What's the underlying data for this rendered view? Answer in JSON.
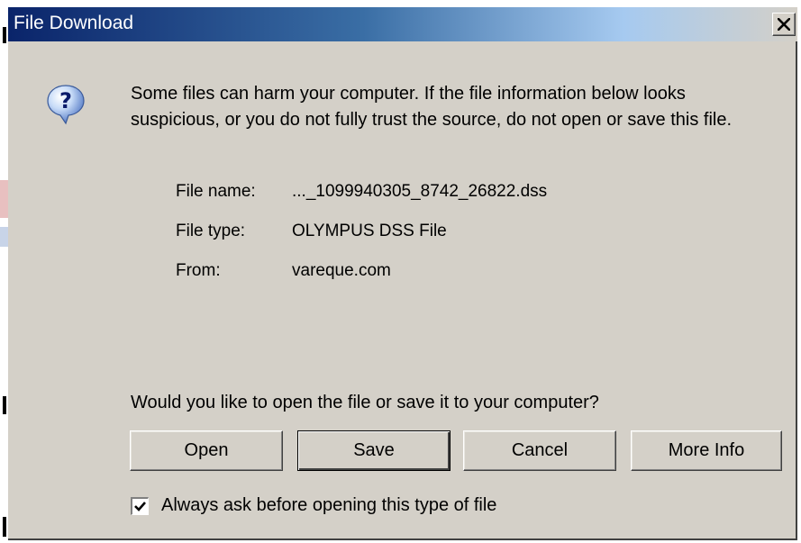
{
  "window": {
    "title": "File Download",
    "close_icon": "close-icon"
  },
  "icon": {
    "name": "question-mark-icon",
    "glyph": "?"
  },
  "warning": {
    "text": "Some files can harm your computer. If the file information below looks suspicious, or you do not fully trust the source, do not open or save this file."
  },
  "file_info": {
    "name_label": "File name:",
    "name_value": "..._1099940305_8742_26822.dss",
    "type_label": "File type:",
    "type_value": "OLYMPUS DSS File",
    "from_label": "From:",
    "from_value": "vareque.com"
  },
  "prompt": {
    "text": "Would you like to open the file or save it to your computer?"
  },
  "buttons": {
    "open": "Open",
    "save": "Save",
    "cancel": "Cancel",
    "more_info": "More Info"
  },
  "checkbox": {
    "label": "Always ask before opening this type of file",
    "checked": true
  },
  "colors": {
    "titlebar_start": "#0a246a",
    "titlebar_end": "#d4d0c8",
    "dialog_face": "#d4d0c8"
  }
}
